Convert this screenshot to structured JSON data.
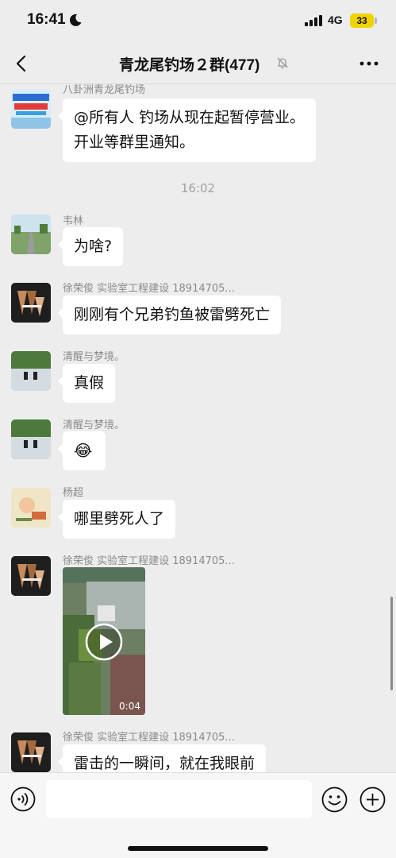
{
  "status_bar": {
    "time": "16:41",
    "network": "4G",
    "battery": "33",
    "moon_icon": "moon-icon",
    "signal_icon": "signal-bars-icon"
  },
  "header": {
    "title": "青龙尾钓场２群(477)",
    "back_icon": "chevron-left-icon",
    "mute_icon": "bell-muted-icon",
    "more_icon": "more-dots-icon"
  },
  "messages": [
    {
      "sender": "八卦洲青龙尾钓场",
      "lines": [
        "@所有人 钓场从现在起暂停营业。",
        "开业等群里通知。"
      ]
    },
    {
      "timestamp": "16:02"
    },
    {
      "sender": "韦林",
      "text": "为啥?"
    },
    {
      "sender": "徐荣俊 实验室工程建设 18914705...",
      "text": "刚刚有个兄弟钓鱼被雷劈死亡"
    },
    {
      "sender": "清醒与梦境。",
      "text": "真假"
    },
    {
      "sender": "清醒与梦境。",
      "emoji": "😂"
    },
    {
      "sender": "杨超",
      "text": "哪里劈死人了"
    },
    {
      "sender": "徐荣俊 实验室工程建设 18914705...",
      "video_duration": "0:04"
    },
    {
      "sender": "徐荣俊 实验室工程建设 18914705...",
      "text": "雷击的一瞬间，就在我眼前"
    }
  ],
  "input_bar": {
    "placeholder": "",
    "voice_icon": "voice-icon",
    "emoji_icon": "emoji-icon",
    "plus_icon": "plus-icon"
  }
}
